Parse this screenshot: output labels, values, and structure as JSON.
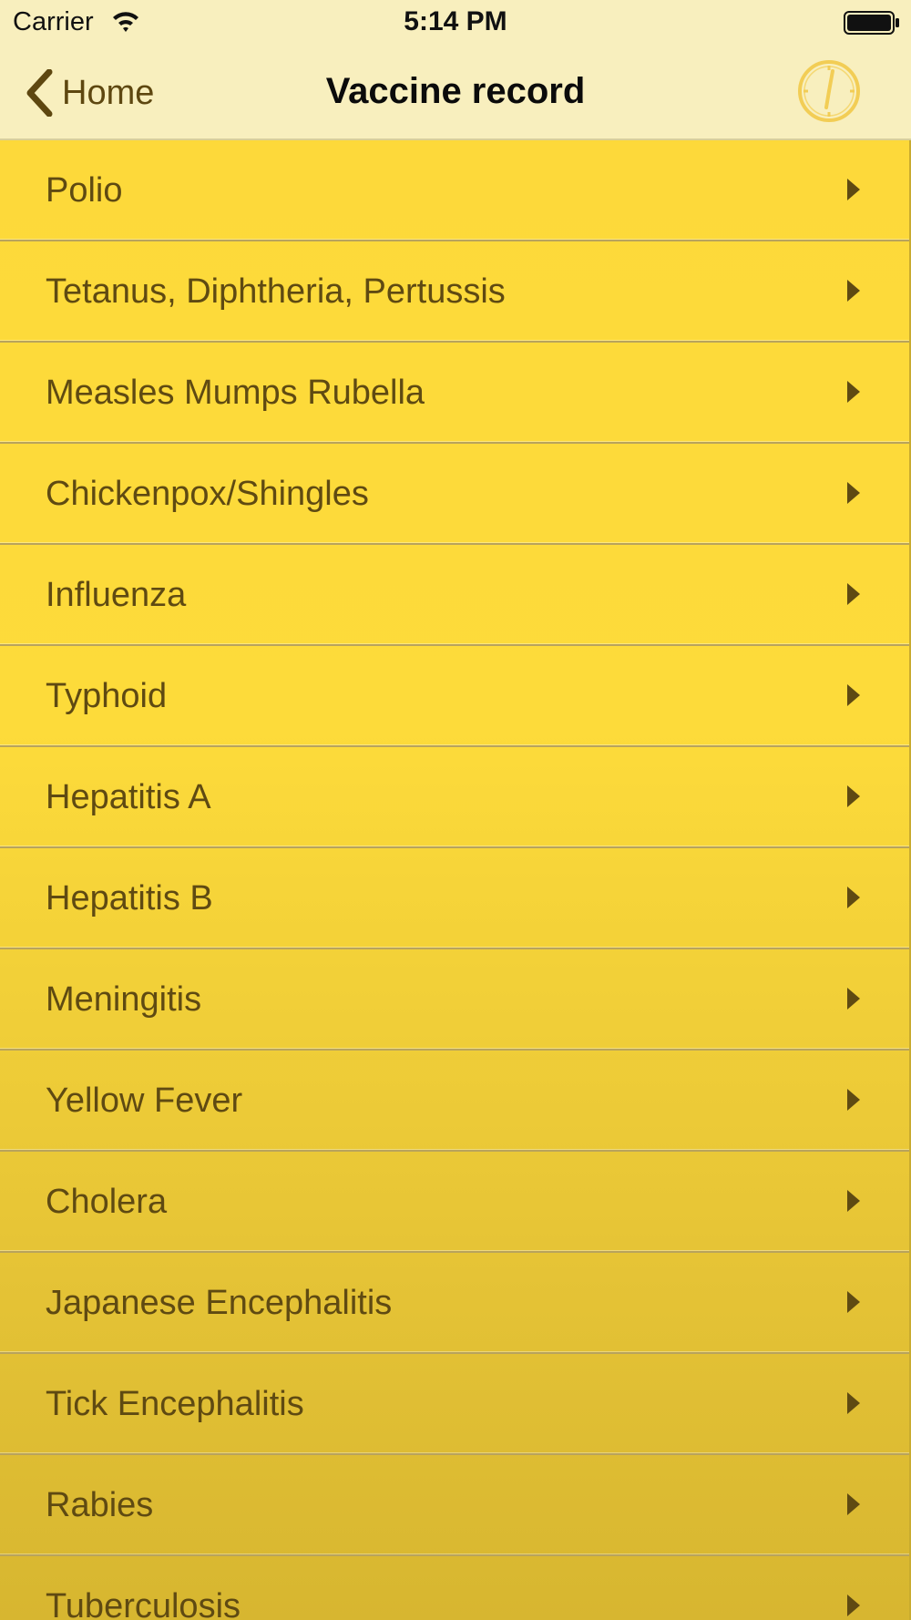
{
  "status_bar": {
    "carrier": "Carrier",
    "time": "5:14 PM",
    "wifi_icon": "wifi-icon",
    "battery_icon": "battery-icon"
  },
  "nav": {
    "back_label": "Home",
    "back_icon": "chevron-left-icon",
    "title": "Vaccine record",
    "history_icon": "clock-icon"
  },
  "colors": {
    "nav_background": "#f8efbe",
    "list_top": "#fdd93a",
    "list_bottom": "#d7b630",
    "label_text": "#5f4a12",
    "clock_icon": "#f2cd55"
  },
  "list": {
    "items": [
      {
        "label": "Polio"
      },
      {
        "label": "Tetanus, Diphtheria, Pertussis"
      },
      {
        "label": "Measles Mumps Rubella"
      },
      {
        "label": "Chickenpox/Shingles"
      },
      {
        "label": "Influenza"
      },
      {
        "label": "Typhoid"
      },
      {
        "label": "Hepatitis A"
      },
      {
        "label": "Hepatitis B"
      },
      {
        "label": "Meningitis"
      },
      {
        "label": "Yellow Fever"
      },
      {
        "label": "Cholera"
      },
      {
        "label": "Japanese Encephalitis"
      },
      {
        "label": "Tick Encephalitis"
      },
      {
        "label": "Rabies"
      },
      {
        "label": "Tuberculosis"
      }
    ]
  }
}
